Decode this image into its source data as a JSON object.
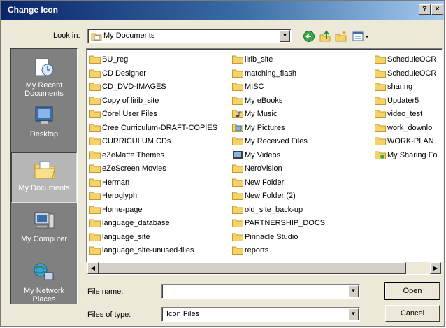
{
  "window": {
    "title": "Change Icon",
    "help_label": "?",
    "close_label": "×"
  },
  "lookin": {
    "label": "Look in:",
    "value": "My Documents"
  },
  "toolbar": {
    "back_icon": "back-arrow-icon",
    "up_icon": "up-folder-icon",
    "new_folder_icon": "new-folder-icon",
    "views_icon": "views-menu-icon"
  },
  "places": [
    {
      "label": "My Recent Documents",
      "icon": "recent-documents-icon"
    },
    {
      "label": "Desktop",
      "icon": "desktop-icon"
    },
    {
      "label": "My Documents",
      "icon": "my-documents-icon"
    },
    {
      "label": "My Computer",
      "icon": "my-computer-icon"
    },
    {
      "label": "My Network Places",
      "icon": "network-places-icon"
    }
  ],
  "files": {
    "col1": [
      {
        "name": "BU_reg",
        "type": "folder"
      },
      {
        "name": "CD Designer",
        "type": "folder"
      },
      {
        "name": "CD_DVD-IMAGES",
        "type": "folder"
      },
      {
        "name": "Copy of lirib_site",
        "type": "folder"
      },
      {
        "name": "Corel User Files",
        "type": "folder"
      },
      {
        "name": "Cree Curriculum-DRAFT-COPIES",
        "type": "folder"
      },
      {
        "name": "CURRICULUM CDs",
        "type": "folder"
      },
      {
        "name": "eZeMatte Themes",
        "type": "folder"
      },
      {
        "name": "eZeScreen Movies",
        "type": "folder"
      },
      {
        "name": "Herman",
        "type": "folder"
      },
      {
        "name": "Heroglyph",
        "type": "folder"
      },
      {
        "name": "Home-page",
        "type": "folder"
      },
      {
        "name": "language_database",
        "type": "folder"
      },
      {
        "name": "language_site",
        "type": "folder"
      },
      {
        "name": "language_site-unused-files",
        "type": "folder"
      }
    ],
    "col2": [
      {
        "name": "lirib_site",
        "type": "folder"
      },
      {
        "name": "matching_flash",
        "type": "folder"
      },
      {
        "name": "MISC",
        "type": "folder"
      },
      {
        "name": "My eBooks",
        "type": "folder"
      },
      {
        "name": "My Music",
        "type": "music"
      },
      {
        "name": "My Pictures",
        "type": "pictures"
      },
      {
        "name": "My Received Files",
        "type": "folder"
      },
      {
        "name": "My Videos",
        "type": "videos"
      },
      {
        "name": "NeroVision",
        "type": "folder"
      },
      {
        "name": "New Folder",
        "type": "folder"
      },
      {
        "name": "New Folder (2)",
        "type": "folder"
      },
      {
        "name": "old_site_back-up",
        "type": "folder"
      },
      {
        "name": "PARTNERSHIP_DOCS",
        "type": "folder"
      },
      {
        "name": "Pinnacle Studio",
        "type": "folder"
      },
      {
        "name": "reports",
        "type": "folder"
      }
    ],
    "col3": [
      {
        "name": "ScheduleOCR",
        "type": "folder"
      },
      {
        "name": "ScheduleOCR",
        "type": "folder"
      },
      {
        "name": "sharing",
        "type": "folder"
      },
      {
        "name": "Updater5",
        "type": "folder"
      },
      {
        "name": "video_test",
        "type": "folder"
      },
      {
        "name": "work_downlo",
        "type": "folder"
      },
      {
        "name": "WORK-PLAN",
        "type": "folder"
      },
      {
        "name": "My Sharing Fo",
        "type": "sharing"
      }
    ]
  },
  "filename": {
    "label": "File name:",
    "value": ""
  },
  "filetype": {
    "label": "Files of type:",
    "value": "Icon Files"
  },
  "buttons": {
    "open": "Open",
    "cancel": "Cancel"
  },
  "colors": {
    "folder": "#f5d36a",
    "folder_edge": "#c49a2a",
    "places_bg": "#808080"
  }
}
